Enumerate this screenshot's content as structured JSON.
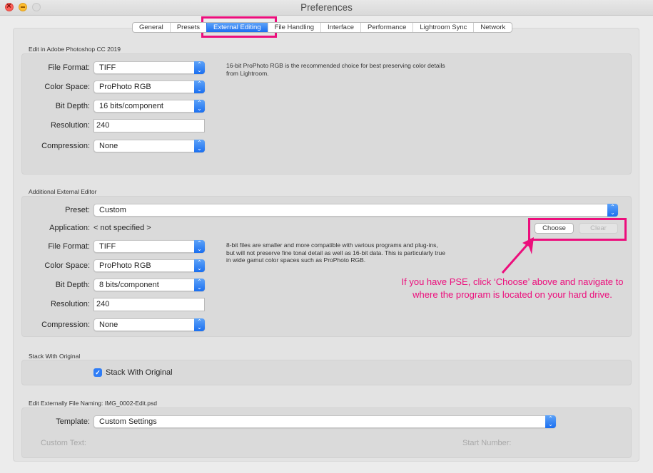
{
  "window": {
    "title": "Preferences",
    "controls": [
      "close",
      "minimize",
      "zoom"
    ]
  },
  "tabs": [
    {
      "label": "General",
      "active": false
    },
    {
      "label": "Presets",
      "active": false
    },
    {
      "label": "External Editing",
      "active": true
    },
    {
      "label": "File Handling",
      "active": false
    },
    {
      "label": "Interface",
      "active": false
    },
    {
      "label": "Performance",
      "active": false
    },
    {
      "label": "Lightroom Sync",
      "active": false
    },
    {
      "label": "Network",
      "active": false
    }
  ],
  "photoshop": {
    "section_title": "Edit in Adobe Photoshop CC 2019",
    "file_format": {
      "label": "File Format:",
      "value": "TIFF"
    },
    "color_space": {
      "label": "Color Space:",
      "value": "ProPhoto RGB"
    },
    "bit_depth": {
      "label": "Bit Depth:",
      "value": "16 bits/component"
    },
    "resolution": {
      "label": "Resolution:",
      "value": "240"
    },
    "compression": {
      "label": "Compression:",
      "value": "None"
    },
    "description": "16-bit ProPhoto RGB is the recommended choice for best preserving color details from Lightroom."
  },
  "additional": {
    "section_title": "Additional External Editor",
    "preset": {
      "label": "Preset:",
      "value": "Custom"
    },
    "application": {
      "label": "Application:",
      "value": "< not specified >"
    },
    "choose_label": "Choose",
    "clear_label": "Clear",
    "file_format": {
      "label": "File Format:",
      "value": "TIFF"
    },
    "color_space": {
      "label": "Color Space:",
      "value": "ProPhoto RGB"
    },
    "bit_depth": {
      "label": "Bit Depth:",
      "value": "8 bits/component"
    },
    "resolution": {
      "label": "Resolution:",
      "value": "240"
    },
    "compression": {
      "label": "Compression:",
      "value": "None"
    },
    "description": "8-bit files are smaller and more compatible with various programs and plug-ins, but will not preserve fine tonal detail as well as 16-bit data. This is particularly true in wide gamut color spaces such as ProPhoto RGB."
  },
  "stack": {
    "section_title": "Stack With Original",
    "checkbox_label": "Stack With Original",
    "checked": true
  },
  "naming": {
    "section_title": "Edit Externally File Naming:  IMG_0002-Edit.psd",
    "template": {
      "label": "Template:",
      "value": "Custom Settings"
    },
    "custom_text_label": "Custom Text:",
    "start_number_label": "Start Number:"
  },
  "annotation": {
    "text_line1": "If you have PSE, click ‘Choose’ above and navigate to",
    "text_line2": "where the program is located on your hard drive.",
    "color": "#ec0e7c"
  },
  "colors": {
    "accent": "#1b6ff0",
    "highlight": "#ec0e7c"
  }
}
